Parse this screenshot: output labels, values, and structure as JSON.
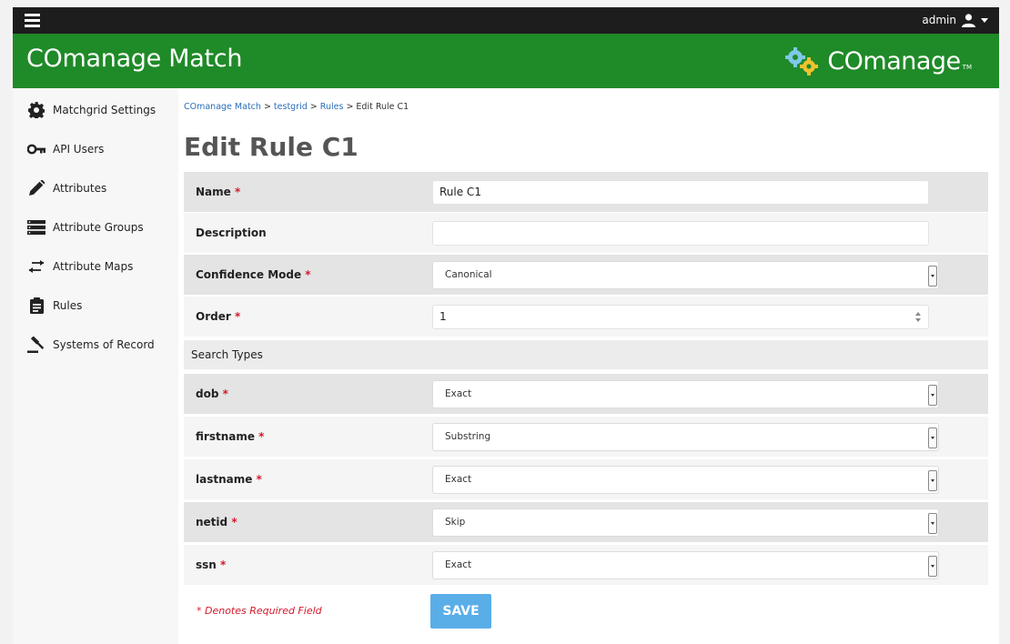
{
  "header": {
    "menu_icon": "hamburger-menu-icon",
    "user": {
      "label": "admin",
      "icon": "user-icon",
      "caret": "caret-down-icon"
    }
  },
  "banner": {
    "app_title": "COmanage Match",
    "brand_name": "COmanage",
    "brand_tm": "TM",
    "color": "#1f8a28"
  },
  "sidebar": {
    "items": [
      {
        "label": "Matchgrid Settings",
        "icon": "gear-icon"
      },
      {
        "label": "API Users",
        "icon": "key-icon"
      },
      {
        "label": "Attributes",
        "icon": "pencil-icon"
      },
      {
        "label": "Attribute Groups",
        "icon": "server-icon"
      },
      {
        "label": "Attribute Maps",
        "icon": "exchange-arrows-icon"
      },
      {
        "label": "Rules",
        "icon": "clipboard-icon"
      },
      {
        "label": "Systems of Record",
        "icon": "gavel-icon"
      }
    ]
  },
  "breadcrumb": {
    "items": [
      "COmanage Match",
      "testgrid",
      "Rules"
    ],
    "separator": " > ",
    "current": "Edit Rule C1"
  },
  "page": {
    "title": "Edit Rule C1"
  },
  "form": {
    "required_marker": "*",
    "name": {
      "label": "Name",
      "value": "Rule C1"
    },
    "description": {
      "label": "Description",
      "value": ""
    },
    "confidence_mode": {
      "label": "Confidence Mode",
      "value": "Canonical"
    },
    "order": {
      "label": "Order",
      "value": "1"
    },
    "search_types_header": "Search Types",
    "search_types": [
      {
        "label": "dob",
        "value": "Exact"
      },
      {
        "label": "firstname",
        "value": "Substring"
      },
      {
        "label": "lastname",
        "value": "Exact"
      },
      {
        "label": "netid",
        "value": "Skip"
      },
      {
        "label": "ssn",
        "value": "Exact"
      }
    ],
    "required_note": "* Denotes Required Field",
    "save_label": "SAVE"
  },
  "colors": {
    "accent": "#5aaee8",
    "required": "#d4192c",
    "topbar": "#1d1d1d",
    "link": "#2a6ebb"
  }
}
